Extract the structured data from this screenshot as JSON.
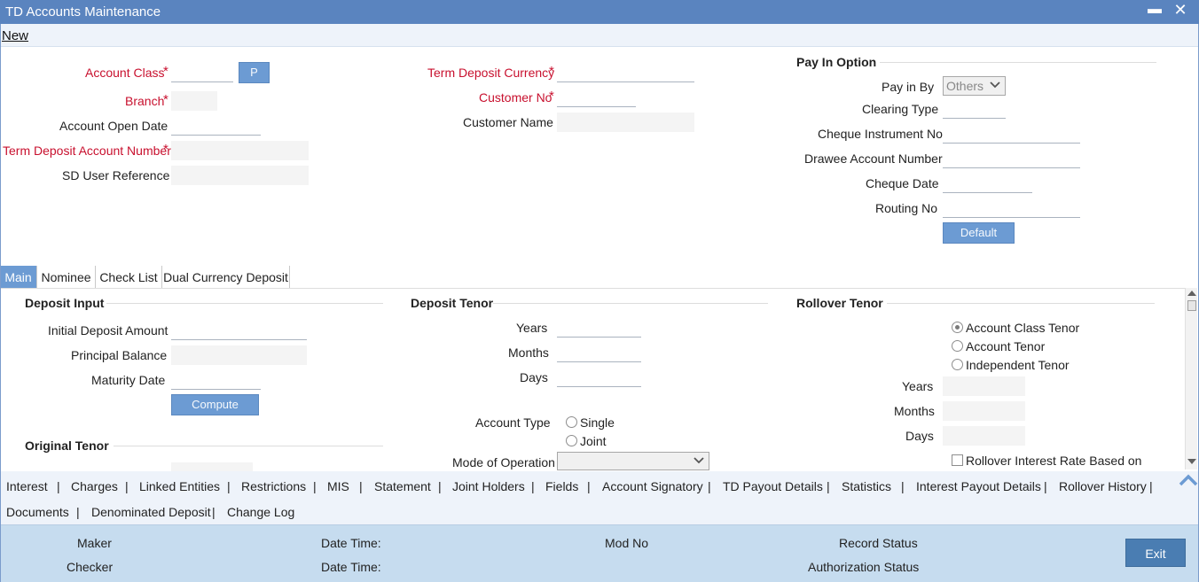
{
  "window": {
    "title": "TD Accounts Maintenance",
    "minimize": "▬",
    "close": "✕"
  },
  "menu": {
    "new_label": "New"
  },
  "header_form": {
    "account_class": "Account Class",
    "p_button": "P",
    "branch": "Branch",
    "account_open_date": "Account Open Date",
    "td_account_number": "Term Deposit Account Number",
    "sd_user_reference": "SD User Reference",
    "td_currency": "Term Deposit Currency",
    "customer_no": "Customer No",
    "customer_name": "Customer Name",
    "required_mark": "*"
  },
  "pay_in": {
    "section_title": "Pay In Option",
    "pay_in_by": "Pay in By",
    "pay_in_by_value": "Others",
    "clearing_type": "Clearing Type",
    "cheque_instrument_no": "Cheque Instrument No",
    "drawee_account_number": "Drawee Account Number",
    "cheque_date": "Cheque Date",
    "routing_no": "Routing No",
    "default_button": "Default"
  },
  "tabs": [
    "Main",
    "Nominee",
    "Check List",
    "Dual Currency Deposit"
  ],
  "deposit_input": {
    "section_title": "Deposit Input",
    "initial_deposit_amount": "Initial Deposit Amount",
    "principal_balance": "Principal Balance",
    "maturity_date": "Maturity Date",
    "compute_button": "Compute",
    "original_tenor": "Original Tenor"
  },
  "deposit_tenor": {
    "section_title": "Deposit Tenor",
    "years": "Years",
    "months": "Months",
    "days": "Days",
    "account_type": "Account Type",
    "single": "Single",
    "joint": "Joint",
    "mode_of_operation": "Mode of Operation"
  },
  "rollover_tenor": {
    "section_title": "Rollover Tenor",
    "account_class_tenor": "Account Class Tenor",
    "account_tenor": "Account Tenor",
    "independent_tenor": "Independent Tenor",
    "years": "Years",
    "months": "Months",
    "days": "Days",
    "rollover_interest_rate": "Rollover Interest Rate Based on"
  },
  "links": {
    "interest": "Interest",
    "charges": "Charges",
    "linked_entities": "Linked Entities",
    "restrictions": "Restrictions",
    "mis": "MIS",
    "statement": "Statement",
    "joint_holders": "Joint Holders",
    "fields": "Fields",
    "account_signatory": "Account Signatory",
    "td_payout_details": "TD Payout Details",
    "statistics": "Statistics",
    "interest_payout_details": "Interest Payout Details",
    "rollover_history": "Rollover History",
    "documents": "Documents",
    "denominated_deposit": "Denominated Deposit",
    "change_log": "Change Log",
    "separator": "|"
  },
  "footer": {
    "maker": "Maker",
    "checker": "Checker",
    "date_time_1": "Date Time:",
    "date_time_2": "Date Time:",
    "mod_no": "Mod No",
    "record_status": "Record Status",
    "authorization_status": "Authorization Status",
    "exit_button": "Exit"
  }
}
